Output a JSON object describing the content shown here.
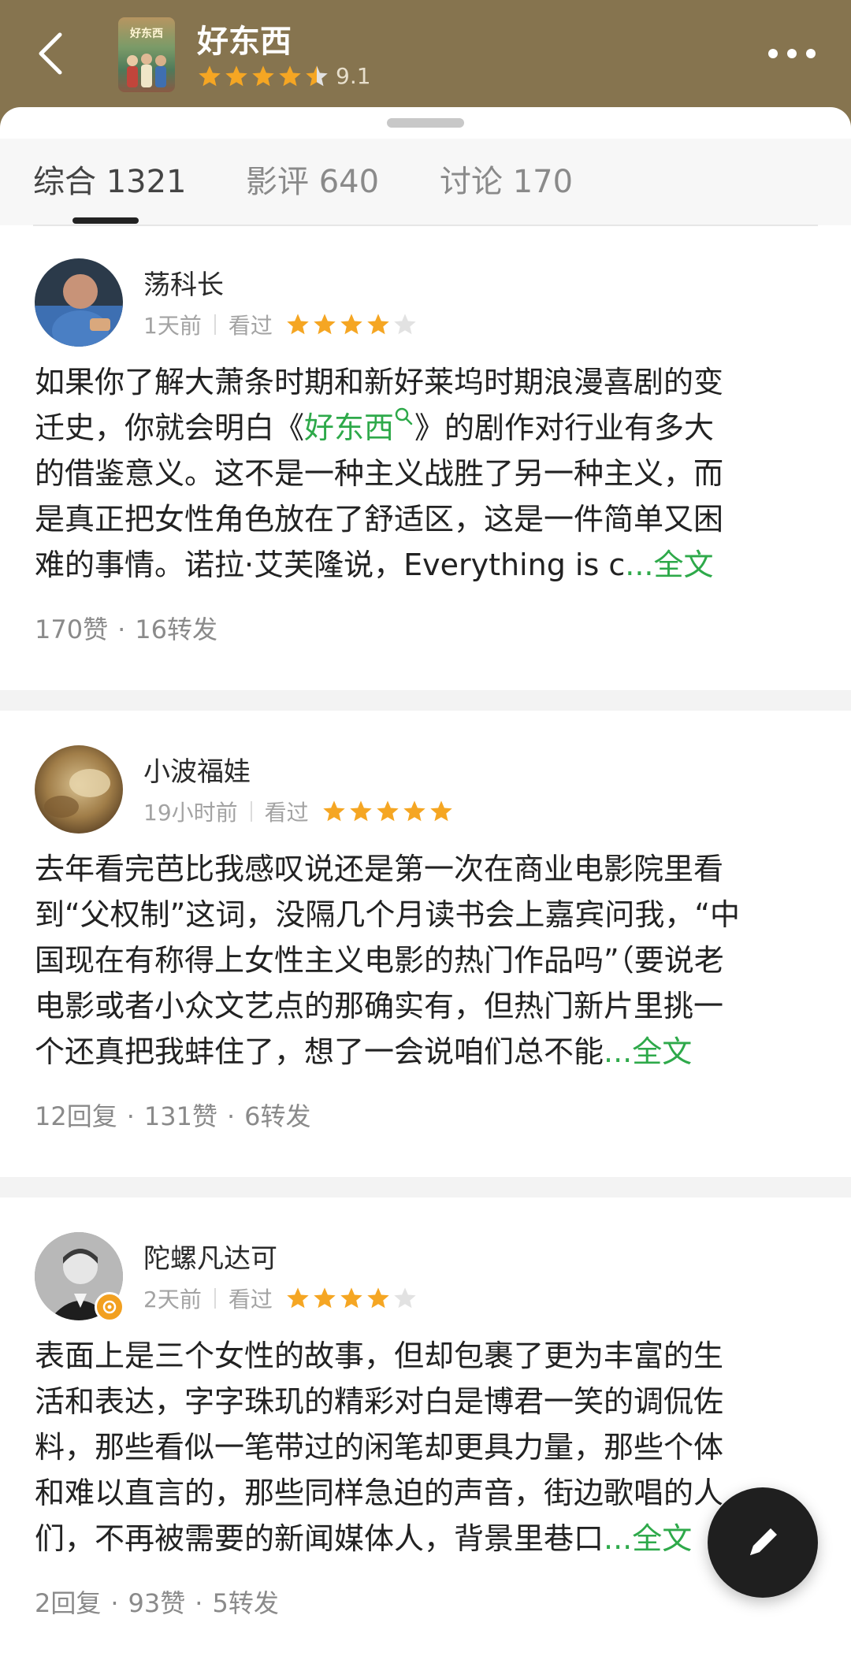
{
  "header": {
    "title": "好东西",
    "rating_value": "9.1",
    "rating_stars": 4.5,
    "poster_text": "好东西",
    "colors": {
      "background": "#86744f",
      "star": "#f5a623"
    }
  },
  "tabs": [
    {
      "label": "综合 1321",
      "active": true
    },
    {
      "label": "影评 640",
      "active": false
    },
    {
      "label": "讨论 170",
      "active": false
    }
  ],
  "reviews": [
    {
      "author": "荡科长",
      "time": "1天前",
      "status": "看过",
      "stars": 4,
      "lines": [
        "如果你了解大萧条时期和新好莱坞时期浪漫喜剧的变",
        "迁史，你就会明白《",
        "》的剧作对行业有多大",
        "的借鉴意义。这不是一种主义战胜了另一种主义，而",
        "是真正把女性角色放在了舒适区，这是一件简单又困",
        "难的事情。诺拉·艾芙隆说，Everything is c",
        "...全文"
      ],
      "link_title": "好东西",
      "stats": [
        "170赞",
        "16转发"
      ]
    },
    {
      "author": "小波福娃",
      "time": "19小时前",
      "status": "看过",
      "stars": 5,
      "lines": [
        "去年看完芭比我感叹说还是第一次在商业电影院里看",
        "到“父权制”这词，没隔几个月读书会上嘉宾问我，“中",
        "国现在有称得上女性主义电影的热门作品吗”（要说老",
        "电影或者小众文艺点的那确实有，但热门新片里挑一",
        "个还真把我蚌住了，想了一会说咱们总不能",
        "...全文"
      ],
      "stats": [
        "12回复",
        "131赞",
        "6转发"
      ]
    },
    {
      "author": "陀螺凡达可",
      "time": "2天前",
      "status": "看过",
      "stars": 4,
      "lines": [
        "表面上是三个女性的故事，但却包裹了更为丰富的生",
        "活和表达，字字珠玑的精彩对白是博君一笑的调侃佐",
        "料，那些看似一笔带过的闲笔却更具力量，那些个体",
        "和难以直言的，那些同样急迫的声音，街边歌唱的人",
        "们，不再被需要的新闻媒体人，背景里巷口",
        "...全文"
      ],
      "stats": [
        "2回复",
        "93赞",
        "5转发"
      ]
    }
  ],
  "fab": {
    "icon": "pen-icon"
  }
}
